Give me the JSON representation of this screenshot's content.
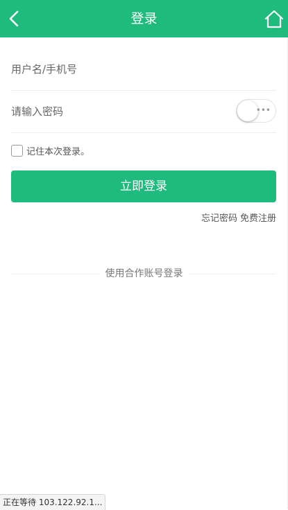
{
  "theme": {
    "brand_color": "#1fbb7c"
  },
  "header": {
    "title": "登录",
    "back_icon": "chevron-left-icon",
    "home_icon": "home-icon"
  },
  "form": {
    "username_placeholder": "用户名/手机号",
    "password_placeholder": "请输入密码",
    "password_visibility_toggle": "off",
    "toggle_dots": "•••",
    "remember_label": "记住本次登录。",
    "remember_checked": false,
    "login_button": "立即登录"
  },
  "links": {
    "forgot_password": "忘记密码",
    "register": "免费注册"
  },
  "partner": {
    "label": "使用合作账号登录"
  },
  "status_bar": {
    "text": "正在等待 103.122.92.1..."
  }
}
